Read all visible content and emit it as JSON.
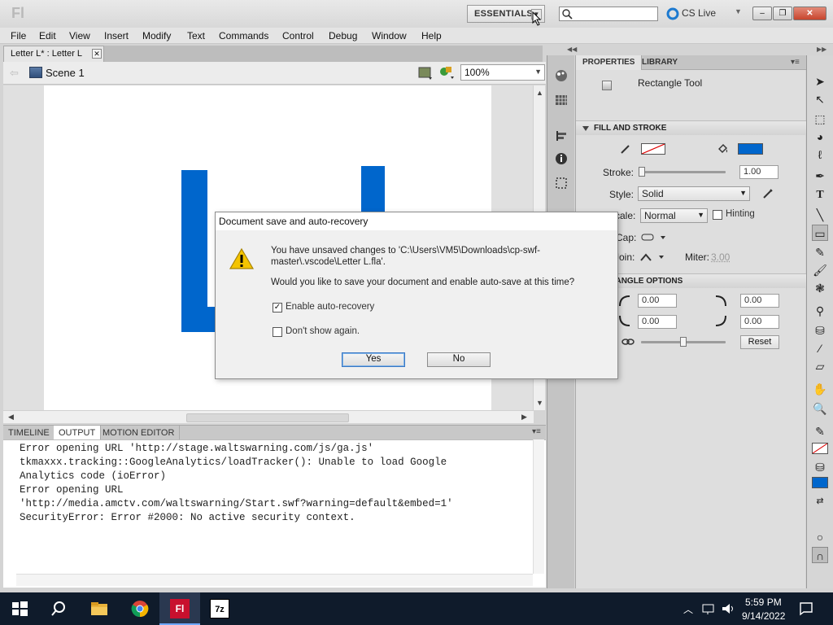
{
  "titlebar": {
    "logo": "Fl",
    "workspace": "ESSENTIALS",
    "search_placeholder": "",
    "cs_live": "CS Live",
    "minimize": "–",
    "restore": "❐",
    "close": "✕"
  },
  "menu": [
    "File",
    "Edit",
    "View",
    "Insert",
    "Modify",
    "Text",
    "Commands",
    "Control",
    "Debug",
    "Window",
    "Help"
  ],
  "document": {
    "tab_label": "Letter L* : Letter L",
    "scene": "Scene 1",
    "zoom": "100%",
    "stage_color": "#0066cc"
  },
  "output_panel": {
    "tabs": [
      "TIMELINE",
      "OUTPUT",
      "MOTION EDITOR"
    ],
    "active_tab": "OUTPUT",
    "lines": [
      "Error opening URL 'http://stage.waltswarning.com/js/ga.js'",
      "tkmaxxx.tracking::GoogleAnalytics/loadTracker(): Unable to load Google",
      "Analytics code (ioError)",
      "Error opening URL",
      "'http://media.amctv.com/waltswarning/Start.swf?warning=default&embed=1'",
      "SecurityError: Error #2000: No active security context."
    ]
  },
  "properties": {
    "tabs": [
      "PROPERTIES",
      "LIBRARY"
    ],
    "tool_name": "Rectangle Tool",
    "fill_stroke_header": "FILL AND STROKE",
    "fill_color": "#0066cc",
    "stroke_label": "Stroke:",
    "stroke_value": "1.00",
    "style_label": "Style:",
    "style_value": "Solid",
    "scale_label": "Scale:",
    "scale_value": "Normal",
    "hinting_label": "Hinting",
    "cap_label": "Cap:",
    "join_label": "Join:",
    "miter_label": "Miter:",
    "miter_value": "3.00",
    "rect_options_header": "RECTANGLE OPTIONS",
    "corners": [
      "0.00",
      "0.00",
      "0.00",
      "0.00"
    ],
    "reset_label": "Reset"
  },
  "dialog": {
    "title": "Document save and auto-recovery",
    "message_line1": "You have unsaved changes to 'C:\\Users\\VM5\\Downloads\\cp-swf-master\\.vscode\\Letter L.fla'.",
    "message_line2": "Would you like to save your document and enable auto-save at this time?",
    "enable_label": "Enable auto-recovery",
    "enable_checked": true,
    "dont_show_label": "Don't show again.",
    "dont_show_checked": false,
    "yes_label": "Yes",
    "no_label": "No"
  },
  "taskbar": {
    "time": "5:59 PM",
    "date": "9/14/2022"
  }
}
